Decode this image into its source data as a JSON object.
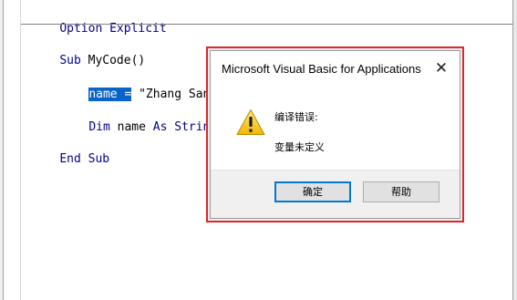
{
  "editor": {
    "lines": [
      {
        "parts": [
          {
            "kw": "Option Explicit"
          }
        ]
      },
      {
        "parts": [
          {
            "kw": "Sub"
          },
          {
            "text": " MyCode()"
          }
        ]
      },
      {
        "selected": "name =",
        "rest": " \"Zhang San\""
      },
      {
        "parts": [
          {
            "kw": "Dim"
          },
          {
            "text": " name "
          },
          {
            "kw": "As"
          },
          {
            "text": " "
          },
          {
            "kw": "String"
          }
        ]
      },
      {
        "parts": [
          {
            "kw": "End Sub"
          }
        ]
      }
    ],
    "line1": "Option Explicit",
    "line2_kw": "Sub",
    "line2_rest": " MyCode()",
    "line3_selected": "name =",
    "line3_rest": " \"Zhang San\"",
    "line4_kw1": "Dim",
    "line4_mid": " name ",
    "line4_kw2": "As",
    "line4_kw3": "String",
    "line5": "End Sub"
  },
  "dialog": {
    "title": "Microsoft Visual Basic for Applications",
    "close_glyph": "✕",
    "icon": "warning-icon",
    "message_heading": "编译错误:",
    "message_detail": "变量未定义",
    "ok_label": "确定",
    "help_label": "帮助",
    "highlight_color": "#e0242b"
  }
}
